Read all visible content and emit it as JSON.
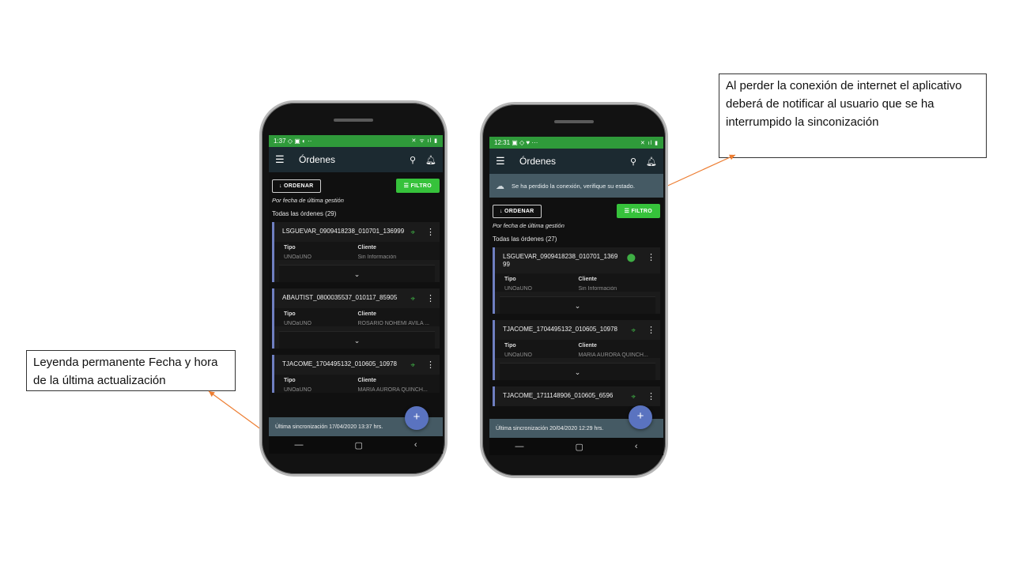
{
  "callouts": {
    "left": "Leyenda permanente Fecha y hora de la última actualización",
    "right": "Al perder la conexión de internet el aplicativo deberá de notificar al usuario que se ha interrumpido la sinconización"
  },
  "colors": {
    "accent": "#36c23b",
    "statusbar": "#2f9a3a",
    "appbar": "#1c2a31",
    "banner": "#455a64",
    "arrow": "#ed7d31"
  },
  "phone1": {
    "status_time": "1:37",
    "status_icons_left": "◇ ▣ ◐ ··",
    "status_icons_right": "✕ ᯤ ıl ▮",
    "title": "Órdenes",
    "order_label": "ORDENAR",
    "filter_label": "FILTRO",
    "sort_info": "Por fecha de última gestión",
    "count_label": "Todas las órdenes (29)",
    "cards": [
      {
        "name": "LSGUEVAR_0909418238_010701_136999",
        "tipo_label": "Tipo",
        "tipo": "UNOaUNO",
        "cliente_label": "Cliente",
        "cliente": "Sin Información"
      },
      {
        "name": "ABAUTIST_0800035537_010117_85905",
        "tipo_label": "Tipo",
        "tipo": "UNOaUNO",
        "cliente_label": "Cliente",
        "cliente": "ROSARIO NOHEMI AVILA ..."
      },
      {
        "name": "TJACOME_1704495132_010605_10978",
        "tipo_label": "Tipo",
        "tipo": "UNOaUNO",
        "cliente_label": "Cliente",
        "cliente": "MARIA AURORA QUINCH..."
      }
    ],
    "sync_label": "Última sincronización 17/04/2020 13:37 hrs."
  },
  "phone2": {
    "status_time": "12:31",
    "status_icons_left": "▣ ◇ ♥ ···",
    "status_icons_right": "✕ ıl ▮",
    "title": "Órdenes",
    "banner_text": "Se ha perdido la conexión, verifique su estado.",
    "order_label": "ORDENAR",
    "filter_label": "FILTRO",
    "sort_info": "Por fecha de última gestión",
    "count_label": "Todas las órdenes (27)",
    "cards": [
      {
        "name": "LSGUEVAR_0909418238_010701_136999",
        "tipo_label": "Tipo",
        "tipo": "UNOaUNO",
        "cliente_label": "Cliente",
        "cliente": "Sin Información"
      },
      {
        "name": "TJACOME_1704495132_010605_10978",
        "tipo_label": "Tipo",
        "tipo": "UNOaUNO",
        "cliente_label": "Cliente",
        "cliente": "MARIA AURORA QUINCH..."
      },
      {
        "name": "TJACOME_1711148906_010605_6596"
      }
    ],
    "sync_label": "Última sincronización 20/04/2020 12:29 hrs."
  },
  "icons": {
    "menu": "menu-icon",
    "search": "search-icon",
    "notifications": "bell-icon",
    "pin": "location-pin-icon",
    "more": "more-vert-icon",
    "expand": "chevron-down-icon",
    "add": "plus-icon",
    "offline": "cloud-off-icon"
  }
}
